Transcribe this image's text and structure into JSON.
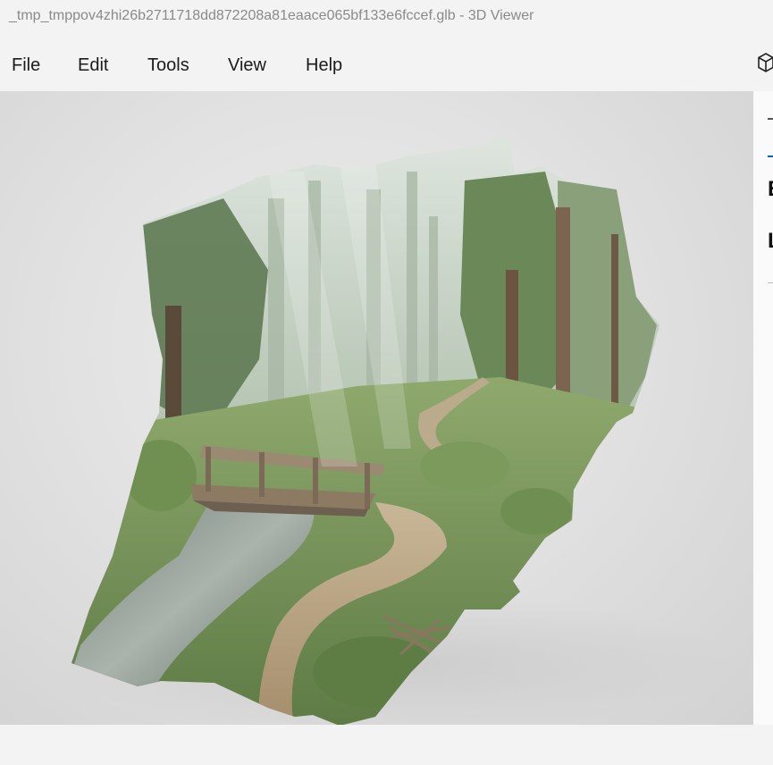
{
  "window": {
    "title": "_tmp_tmppov4zhi26b2711718dd872208a81eaace065bf133e6fccef.glb - 3D Viewer"
  },
  "menu": {
    "items": [
      {
        "label": "File"
      },
      {
        "label": "Edit"
      },
      {
        "label": "Tools"
      },
      {
        "label": "View"
      },
      {
        "label": "Help"
      }
    ],
    "right_icon": "cube-icon"
  },
  "viewport": {
    "model_description_icon": "forest-scene-model"
  },
  "side_panel": {
    "glyph_1": "E",
    "glyph_2": "L"
  },
  "colors": {
    "accent": "#0067c0",
    "viewport_bg": "#e2e2e2",
    "title_text": "#8a8a8a"
  }
}
